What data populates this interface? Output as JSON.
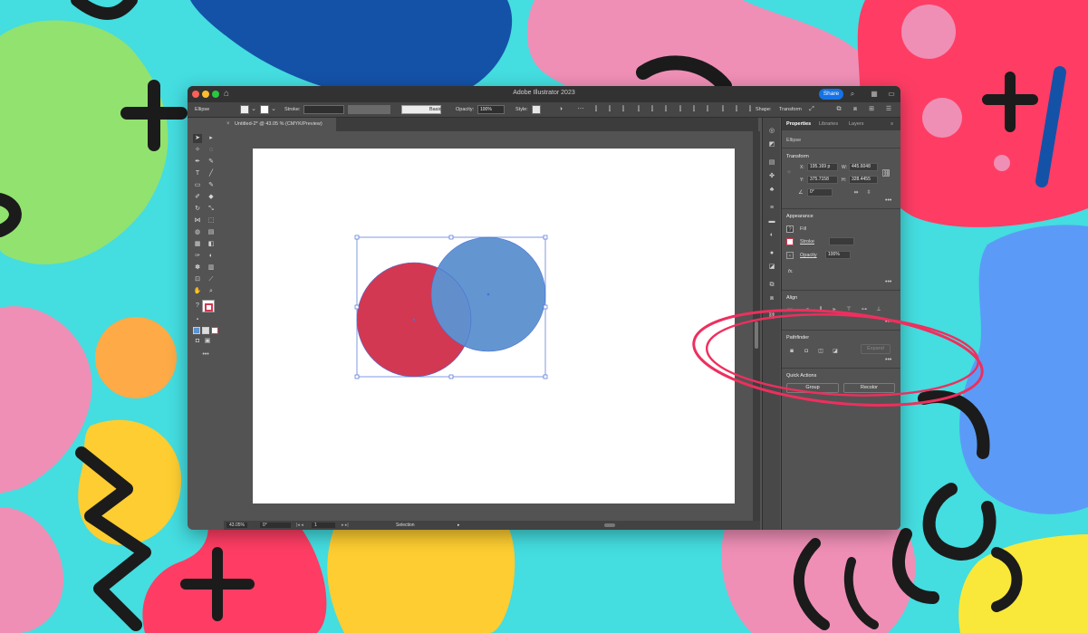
{
  "window": {
    "title": "Adobe Illustrator 2023",
    "share_label": "Share"
  },
  "control_bar": {
    "object_type": "Ellipse",
    "stroke_label": "Stroke:",
    "brush_label": "Basic",
    "opacity_label": "Opacity:",
    "opacity_value": "100%",
    "style_label": "Style:",
    "shape_label": "Shape:",
    "transform_label": "Transform"
  },
  "document_tab": {
    "label": "Untitled-2* @ 43.05 % (CMYK/Preview)"
  },
  "artwork": {
    "red_circle_color": "#d33852",
    "blue_circle_color": "#5e93cf",
    "selection_color": "#4a6fd8"
  },
  "status_bar": {
    "zoom": "43.05%",
    "rotation": "0°",
    "artboard": "1",
    "tool": "Selection"
  },
  "properties_panel": {
    "tabs": [
      "Properties",
      "Libraries",
      "Layers"
    ],
    "selection_type": "Ellipse",
    "transform": {
      "title": "Transform",
      "x_label": "X:",
      "x": "195.169 p",
      "y_label": "Y:",
      "y": "375.7158",
      "w_label": "W:",
      "w": "445.6048",
      "h_label": "H:",
      "h": "328.4455",
      "angle": "0°"
    },
    "appearance": {
      "title": "Appearance",
      "fill_label": "Fill",
      "stroke_label": "Stroke",
      "opacity_label": "Opacity",
      "opacity_value": "100%",
      "fx_label": "fx."
    },
    "align": {
      "title": "Align"
    },
    "pathfinder": {
      "title": "Pathfinder",
      "expand_label": "Expand"
    },
    "quick_actions": {
      "title": "Quick Actions",
      "group_label": "Group",
      "recolor_label": "Recolor"
    }
  },
  "background": {
    "colors": [
      "#44dde0",
      "#1452a8",
      "#92e26f",
      "#ef8fb6",
      "#ff3d64",
      "#fdcd31",
      "#f9e83a",
      "#5b9bf7",
      "#1b1b1b"
    ]
  },
  "annotation": {
    "color": "#ee2f5e"
  }
}
